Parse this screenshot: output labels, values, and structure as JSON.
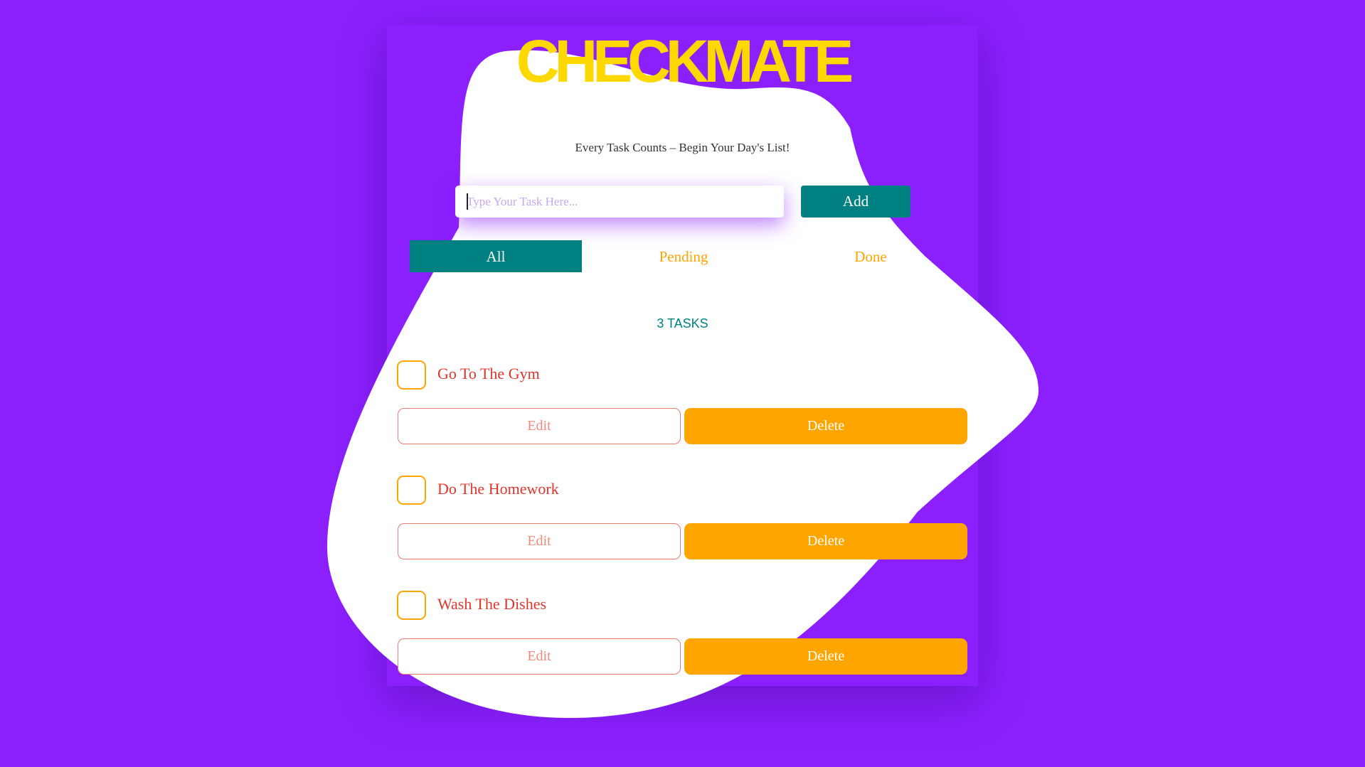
{
  "app": {
    "title": "CHECKMATE",
    "tagline": "Every Task Counts – Begin Your Day's List!"
  },
  "input": {
    "placeholder": "Type Your Task Here...",
    "value": ""
  },
  "add_button": {
    "label": "Add"
  },
  "filters": [
    {
      "label": "All",
      "active": true
    },
    {
      "label": "Pending",
      "active": false
    },
    {
      "label": "Done",
      "active": false
    }
  ],
  "task_count": "3 TASKS",
  "tasks": [
    {
      "label": "Go To The Gym",
      "checked": false,
      "edit_label": "Edit",
      "delete_label": "Delete"
    },
    {
      "label": "Do The Homework",
      "checked": false,
      "edit_label": "Edit",
      "delete_label": "Delete"
    },
    {
      "label": "Wash The Dishes",
      "checked": false,
      "edit_label": "Edit",
      "delete_label": "Delete"
    }
  ],
  "colors": {
    "background": "#8b1ffd",
    "title": "#ffd800",
    "teal": "#008080",
    "orange": "#ffa500",
    "task_text": "#e0352b"
  }
}
